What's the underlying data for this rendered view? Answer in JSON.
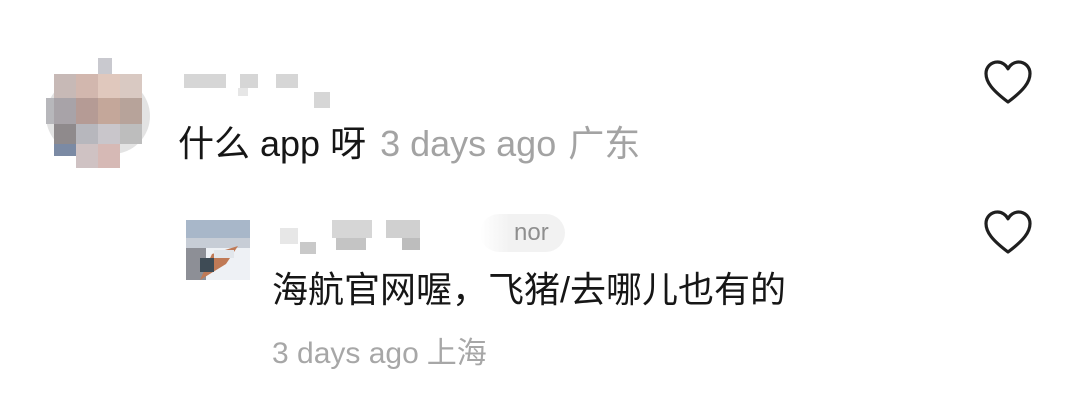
{
  "comments": [
    {
      "text": "什么 app 呀",
      "time": "3 days ago",
      "location": "广东",
      "icon": "heart-outline-icon"
    },
    {
      "author_badge": "nor",
      "text": "海航官网喔，飞猪/去哪儿也有的",
      "time": "3 days ago",
      "location": "上海",
      "icon": "heart-outline-icon"
    }
  ],
  "colors": {
    "text": "#161616",
    "meta": "#a3a3a3",
    "icon": "#1f1f1f",
    "background": "#ffffff"
  }
}
